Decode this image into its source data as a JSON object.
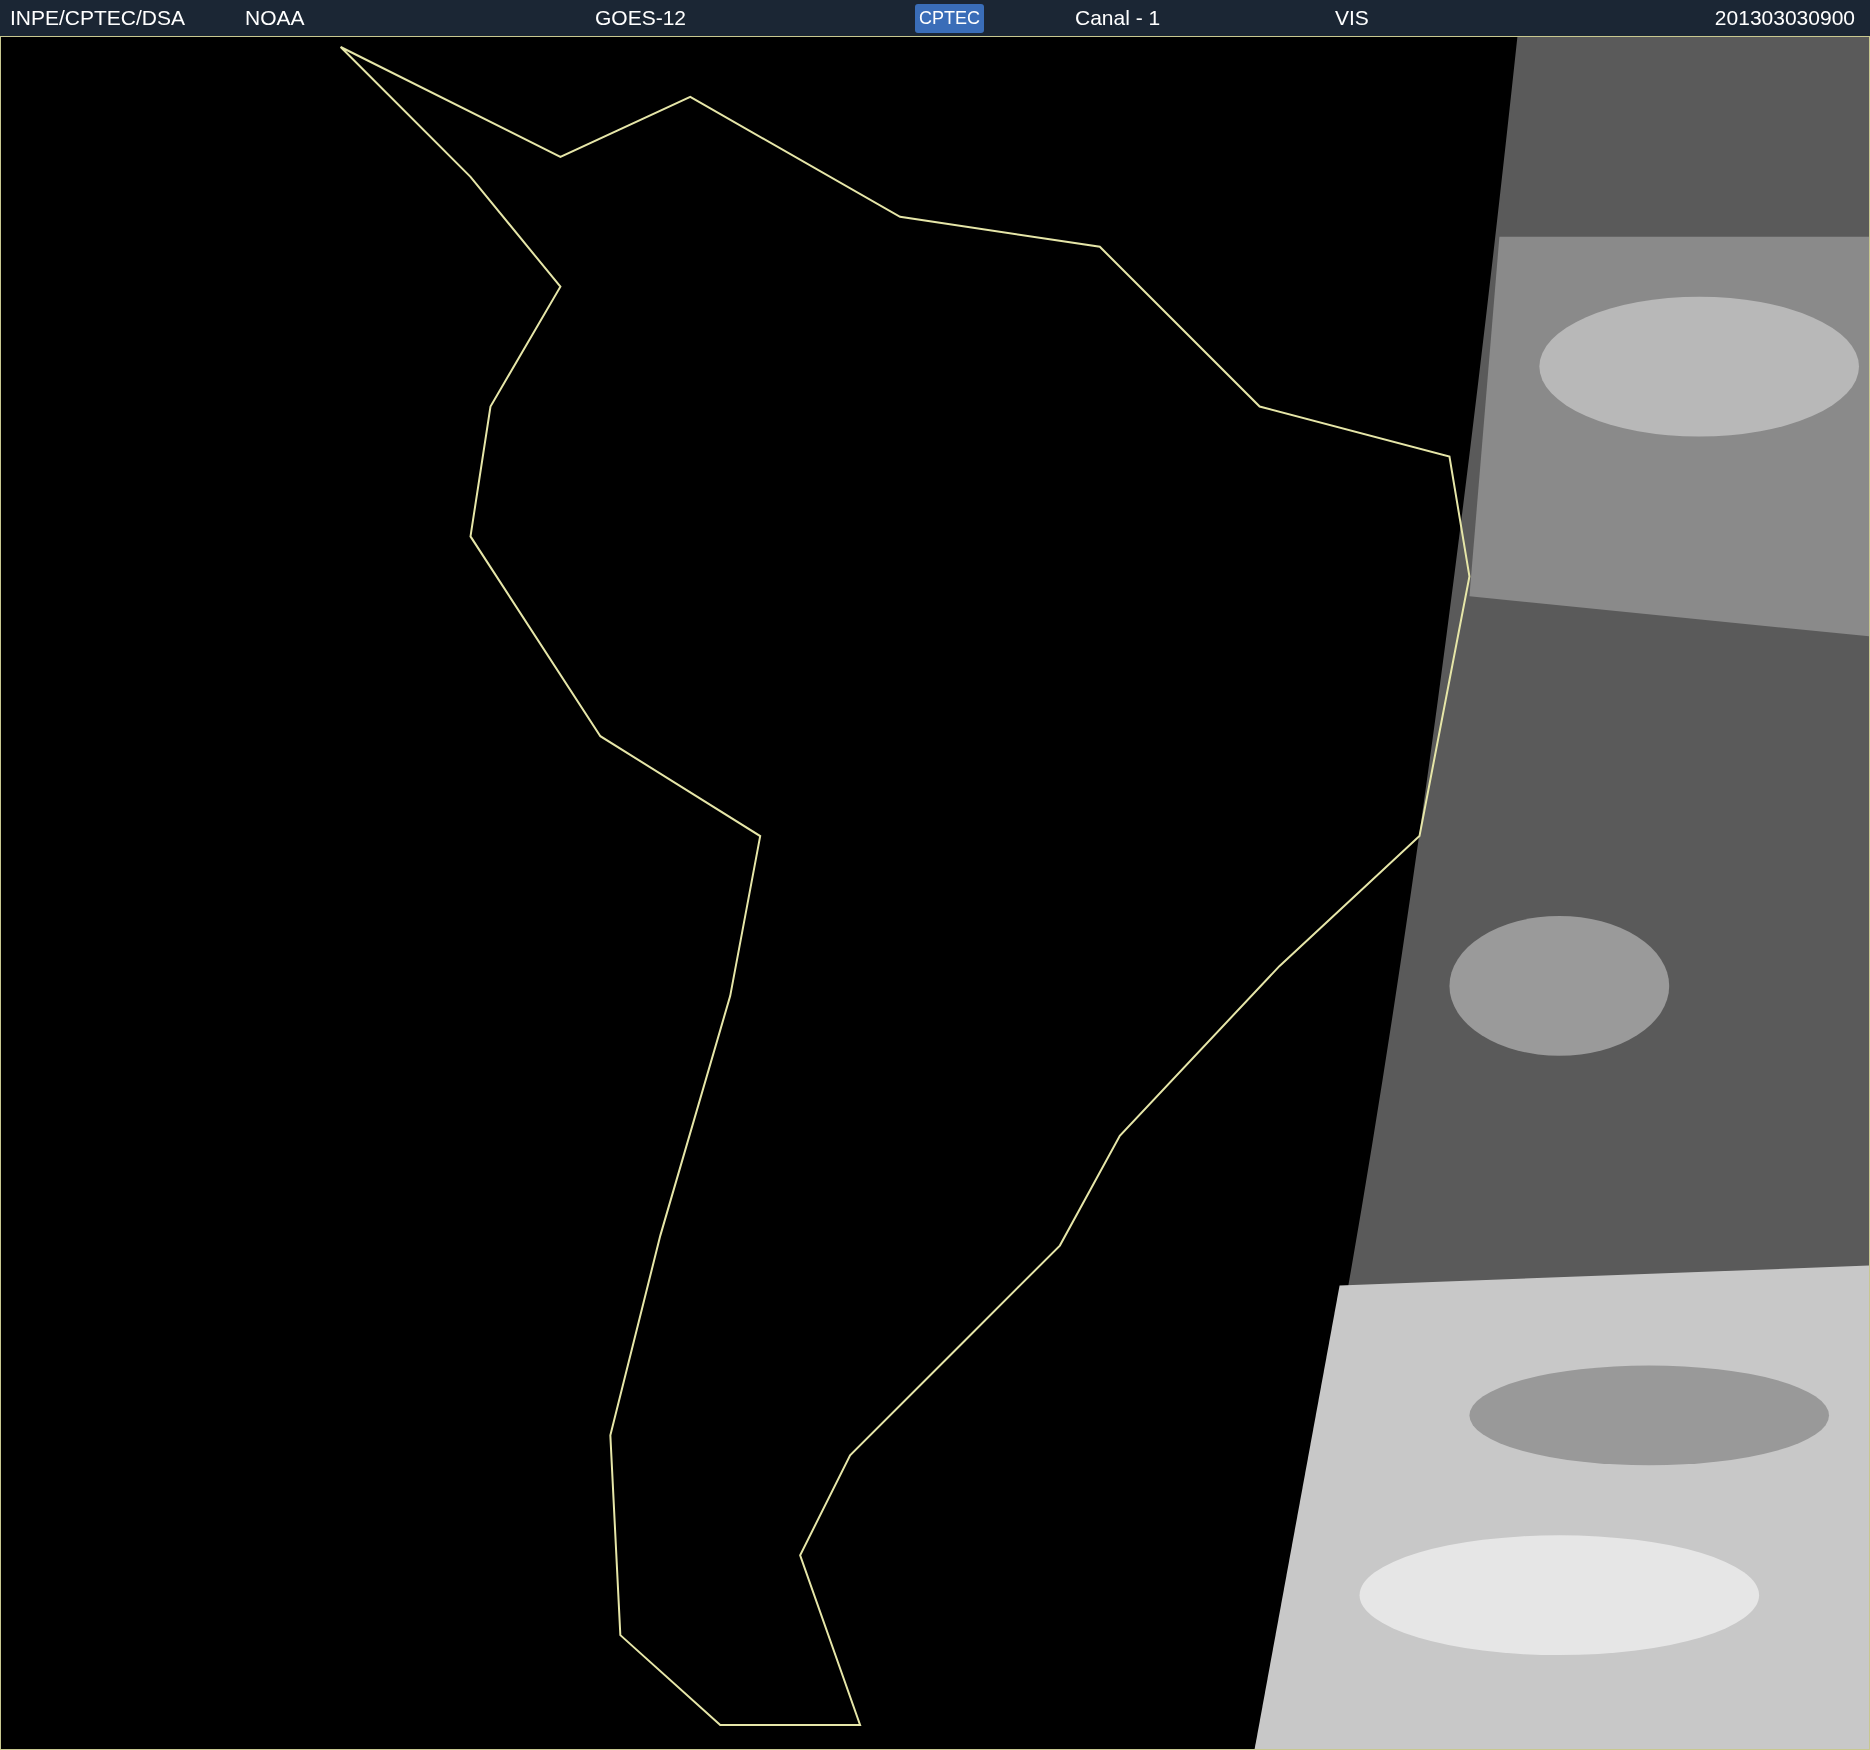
{
  "header": {
    "items": [
      {
        "kind": "text",
        "text": "INPE/CPTEC/DSA"
      },
      {
        "kind": "text",
        "text": "NOAA"
      },
      {
        "kind": "text",
        "text": "GOES-12"
      },
      {
        "kind": "logo",
        "text": "CPTEC"
      },
      {
        "kind": "text",
        "text": "Canal - 1"
      },
      {
        "kind": "text",
        "text": "VIS"
      },
      {
        "kind": "text",
        "text": "201303030900"
      }
    ]
  }
}
